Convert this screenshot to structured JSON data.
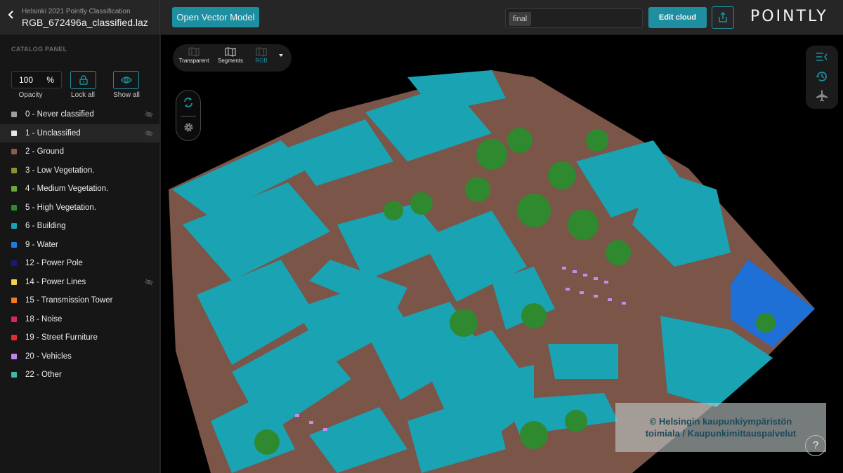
{
  "header": {
    "back_icon": "chevron-left-icon",
    "project_name": "Helsinki 2021 Pointly Classification",
    "file_name": "RGB_672496a_classified.laz",
    "open_vector_label": "Open Vector Model",
    "tag_value": "final",
    "edit_cloud_label": "Edit cloud",
    "share_icon": "share-icon",
    "logo_text": "POINTLY"
  },
  "sidebar": {
    "title": "CATALOG PANEL",
    "opacity_value": "100",
    "opacity_unit": "%",
    "opacity_label": "Opacity",
    "lock_all_label": "Lock all",
    "show_all_label": "Show all",
    "classes": [
      {
        "label": "0 - Never classified",
        "color": "#9e9e9e",
        "hidden": true,
        "selected": false
      },
      {
        "label": "1 - Unclassified",
        "color": "#e6e6e6",
        "hidden": true,
        "selected": true
      },
      {
        "label": "2 - Ground",
        "color": "#8a5a4a",
        "hidden": false,
        "selected": false
      },
      {
        "label": "3 - Low Vegetation.",
        "color": "#8f8f2e",
        "hidden": false,
        "selected": false
      },
      {
        "label": "4 - Medium Vegetation.",
        "color": "#6ea63a",
        "hidden": false,
        "selected": false
      },
      {
        "label": "5 - High Vegetation.",
        "color": "#2e8a2e",
        "hidden": false,
        "selected": false
      },
      {
        "label": "6 - Building",
        "color": "#17a2b8",
        "hidden": false,
        "selected": false
      },
      {
        "label": "9 - Water",
        "color": "#1e7be0",
        "hidden": false,
        "selected": false
      },
      {
        "label": "12 - Power Pole",
        "color": "#1a1a7a",
        "hidden": false,
        "selected": false
      },
      {
        "label": "14 - Power Lines",
        "color": "#f2d14a",
        "hidden": true,
        "selected": false
      },
      {
        "label": "15 - Transmission Tower",
        "color": "#f57c1a",
        "hidden": false,
        "selected": false
      },
      {
        "label": "18 - Noise",
        "color": "#e0245e",
        "hidden": false,
        "selected": false
      },
      {
        "label": "19 - Street Furniture",
        "color": "#e82a2a",
        "hidden": false,
        "selected": false
      },
      {
        "label": "20 - Vehicles",
        "color": "#c084f0",
        "hidden": false,
        "selected": false
      },
      {
        "label": "22 - Other",
        "color": "#3fb8a6",
        "hidden": false,
        "selected": false
      }
    ]
  },
  "viewer": {
    "modes": [
      {
        "label": "Transparent",
        "active": false
      },
      {
        "label": "Segments",
        "active": false
      },
      {
        "label": "RGB",
        "active": true
      }
    ],
    "attribution_line1": "© Helsingin kaupunkiympäristön",
    "attribution_line2": "toimiala / Kaupunkimittauspalvelut",
    "help_label": "?"
  },
  "colors": {
    "accent": "#1e8fa0",
    "topbar_bg": "#262626",
    "sidebar_bg": "#161616",
    "ground": "#7a5548",
    "building": "#1aa3b3",
    "vegetation": "#2f8a2f",
    "water": "#1e6fd6",
    "vehicles": "#c98af0"
  }
}
